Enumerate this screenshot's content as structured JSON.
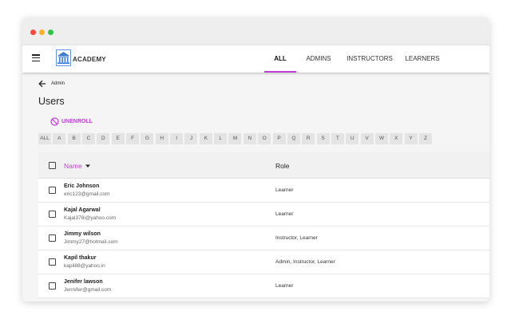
{
  "appbar": {
    "brand": "ACADEMY",
    "tabs": [
      {
        "label": "ALL",
        "active": true
      },
      {
        "label": "ADMINS",
        "active": false
      },
      {
        "label": "INSTRUCTORS",
        "active": false
      },
      {
        "label": "LEARNERS",
        "active": false
      }
    ]
  },
  "breadcrumb": {
    "back_label": "Admin"
  },
  "page": {
    "title": "Users"
  },
  "actions": {
    "unenroll_label": "UNENROLL"
  },
  "alphabet": [
    "ALL",
    "A",
    "B",
    "C",
    "D",
    "E",
    "F",
    "G",
    "H",
    "I",
    "J",
    "K",
    "L",
    "M",
    "N",
    "O",
    "P",
    "Q",
    "R",
    "S",
    "T",
    "U",
    "V",
    "W",
    "X",
    "Y",
    "Z"
  ],
  "table": {
    "headers": {
      "name": "Name",
      "role": "Role"
    },
    "rows": [
      {
        "name": "Eric Johnson",
        "email": "eric123@gmail.com",
        "role": "Learner"
      },
      {
        "name": "Kajal Agarwal",
        "email": "Kajal378i@yahoo.com",
        "role": "Learner"
      },
      {
        "name": "Jimmy wilson",
        "email": "Jimmy27@hotmail.com",
        "role": "Instructor, Learner"
      },
      {
        "name": "Kapil thakur",
        "email": "kapil88@yahoo.in",
        "role": "Admin, Instructor, Learner"
      },
      {
        "name": "Jenifer lawson",
        "email": "Jennifer@gmail.com",
        "role": "Learner"
      }
    ]
  },
  "colors": {
    "accent": "#c040d6",
    "background": "#f5f5f5",
    "header_bg": "#f1f1f1"
  }
}
